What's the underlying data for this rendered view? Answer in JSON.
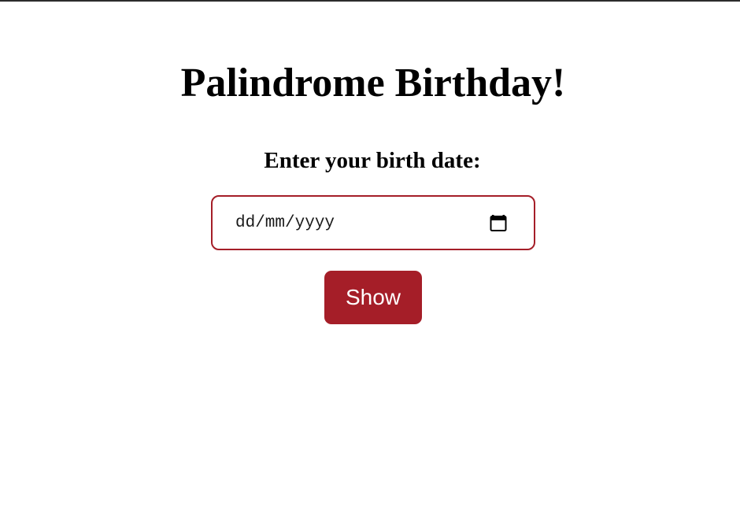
{
  "page": {
    "title": "Palindrome Birthday!"
  },
  "form": {
    "label": "Enter your birth date:",
    "date_placeholder": "dd/mm/yyyy",
    "calendar_icon": "calendar-icon",
    "submit_label": "Show"
  },
  "colors": {
    "accent": "#a51e28",
    "background": "#ffffff",
    "text": "#000000"
  }
}
